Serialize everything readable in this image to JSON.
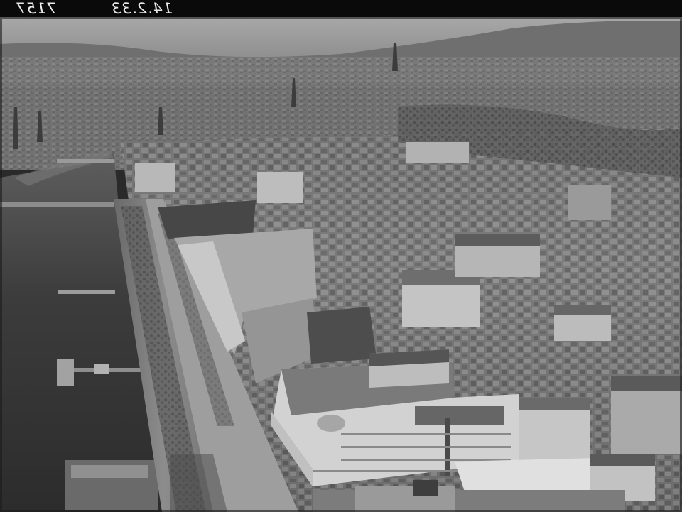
{
  "image": {
    "kind": "monochrome aerial photograph",
    "colors": {
      "sky": "#9c9c9c",
      "haze_hills": "#6e6e6e",
      "city_far": "#7d7d7d",
      "city_mid": "#8a8a8a",
      "city_near": "#b4b4b4",
      "water": "#3a3a3a",
      "film_border": "#0a0a0a",
      "label": "#e8e8e8"
    }
  },
  "negative": {
    "number": "7157",
    "date": "14.2.33"
  }
}
